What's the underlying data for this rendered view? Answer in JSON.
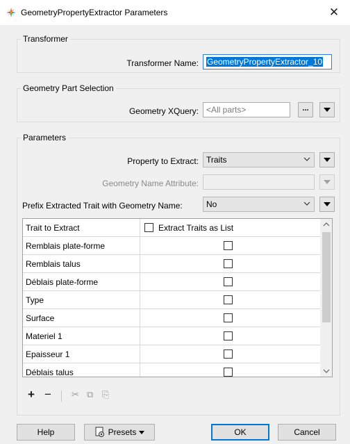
{
  "window": {
    "title": "GeometryPropertyExtractor Parameters",
    "close_glyph": "✕"
  },
  "transformer_group": {
    "label": "Transformer",
    "name_label": "Transformer Name:",
    "name_value": "GeometryPropertyExtractor_10"
  },
  "geometry_group": {
    "label": "Geometry Part Selection",
    "xquery_label": "Geometry XQuery:",
    "xquery_placeholder": "<All parts>",
    "ellipsis_label": "..."
  },
  "parameters_group": {
    "label": "Parameters",
    "property_label": "Property to Extract:",
    "property_value": "Traits",
    "geom_name_label": "Geometry Name Attribute:",
    "geom_name_value": "",
    "prefix_label": "Prefix Extracted Trait with Geometry Name:",
    "prefix_value": "No"
  },
  "traits_table": {
    "col_trait": "Trait to Extract",
    "col_list": "Extract Traits as List",
    "rows": [
      {
        "name": "Remblais plate-forme",
        "checked": false
      },
      {
        "name": "Remblais talus",
        "checked": false
      },
      {
        "name": "Déblais plate-forme",
        "checked": false
      },
      {
        "name": "Type",
        "checked": false
      },
      {
        "name": "Surface",
        "checked": false
      },
      {
        "name": "Materiel 1",
        "checked": false
      },
      {
        "name": "Epaisseur 1",
        "checked": false
      },
      {
        "name": "Déblais talus",
        "checked": false
      }
    ]
  },
  "table_tools": {
    "add": "+",
    "remove": "−",
    "cut": "✂",
    "copy": "⧉",
    "paste": "⎘"
  },
  "footer": {
    "help": "Help",
    "presets": "Presets",
    "ok": "OK",
    "cancel": "Cancel"
  },
  "icons": {
    "app": "fme-transformer-icon",
    "presets": "gear-document-icon",
    "dropdown": "chevron-down-icon",
    "menu": "triangle-down-icon"
  },
  "colors": {
    "accent": "#0078d7",
    "background": "#f0f0f0"
  }
}
